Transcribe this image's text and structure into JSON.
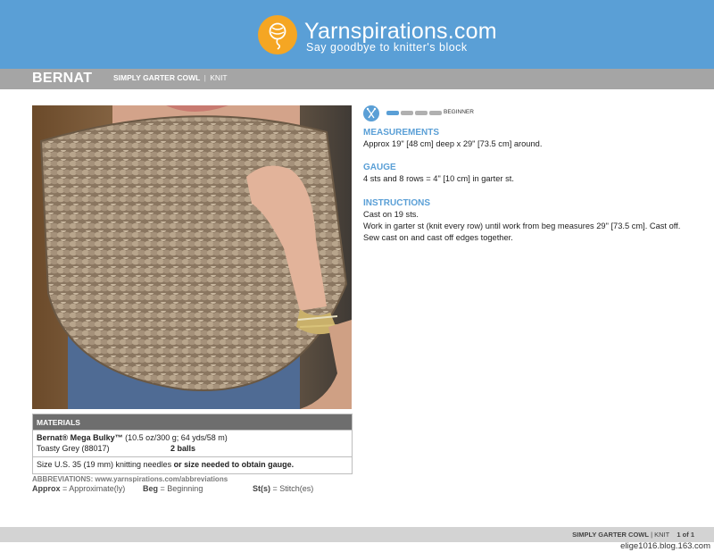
{
  "banner": {
    "brand_name": "Yarnspirations.com",
    "tagline": "Say goodbye to knitter's block",
    "color": "#5a9fd6",
    "logo_color": "#f5a623",
    "logo_icon": "yarn-ball-icon"
  },
  "header": {
    "brand": "BERNAT",
    "pattern_name": "SIMPLY GARTER COWL",
    "separator": "|",
    "craft": "KNIT"
  },
  "skill": {
    "icon": "knitting-needles-icon",
    "level_of": [
      1,
      4
    ],
    "label": "BEGINNER"
  },
  "sections": {
    "measurements": {
      "title": "MEASUREMENTS",
      "text": "Approx 19\" [48 cm] deep x 29\" [73.5 cm] around."
    },
    "gauge": {
      "title": "GAUGE",
      "text": "4 sts and 8 rows = 4\" [10 cm] in garter st."
    },
    "instructions": {
      "title": "INSTRUCTIONS",
      "lines": [
        "Cast on 19 sts.",
        "Work in garter st (knit every row) until work from beg measures 29\" [73.5 cm]. Cast off.",
        "Sew cast on and cast off edges together."
      ]
    }
  },
  "materials": {
    "title": "MATERIALS",
    "yarn_name": "Bernat® Mega Bulky™",
    "yarn_detail": "(10.5 oz/300 g; 64 yds/58 m)",
    "color_name": "Toasty Grey (88017)",
    "quantity": "2 balls",
    "needles_text": "Size U.S. 35 (19 mm) knitting needles",
    "needles_note": "or size needed to obtain gauge."
  },
  "abbreviations": {
    "title": "ABBREVIATIONS: www.yarnspirations.com/abbreviations",
    "items": [
      {
        "term": "Approx",
        "meaning": "= Approximate(ly)"
      },
      {
        "term": "Beg",
        "meaning": "= Beginning"
      },
      {
        "term": "St(s)",
        "meaning": "= Stitch(es)"
      }
    ]
  },
  "footer": {
    "pattern_name": "SIMPLY GARTER COWL",
    "separator": "|",
    "craft": "KNIT",
    "page": "1 of 1"
  },
  "watermark": "elige1016.blog.163.com"
}
